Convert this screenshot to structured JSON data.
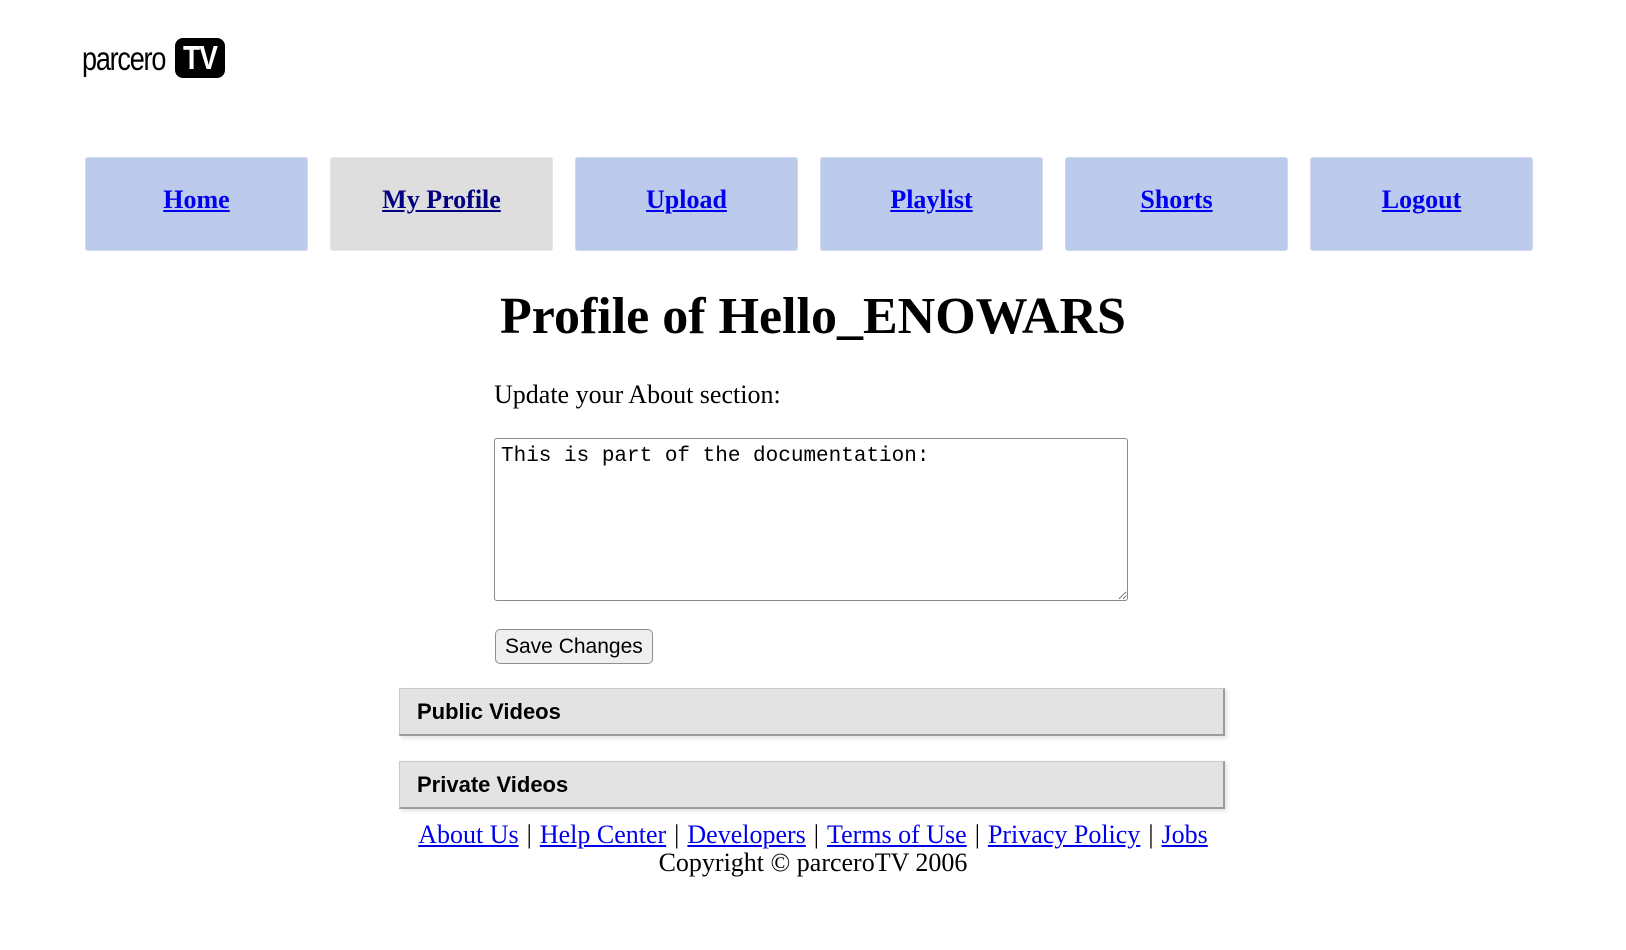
{
  "logo": {
    "word": "parcero",
    "badge": "TV"
  },
  "nav": {
    "items": [
      {
        "label": "Home",
        "active": false
      },
      {
        "label": "My Profile",
        "active": true
      },
      {
        "label": "Upload",
        "active": false
      },
      {
        "label": "Playlist",
        "active": false
      },
      {
        "label": "Shorts",
        "active": false
      },
      {
        "label": "Logout",
        "active": false
      }
    ]
  },
  "profile": {
    "title": "Profile of Hello_ENOWARS",
    "about_label": "Update your About section:",
    "about_value": "This is part of the documentation:",
    "save_label": "Save Changes"
  },
  "sections": {
    "public_label": "Public Videos",
    "private_label": "Private Videos"
  },
  "footer": {
    "links": [
      "About Us",
      "Help Center",
      "Developers",
      "Terms of Use",
      "Privacy Policy",
      "Jobs"
    ],
    "separator": "|",
    "copyright": "Copyright © parceroTV 2006"
  },
  "colors": {
    "nav_bg": "#bccbec",
    "nav_active_bg": "#dedede",
    "link": "#0000ee",
    "section_bg": "#e3e3e3"
  }
}
